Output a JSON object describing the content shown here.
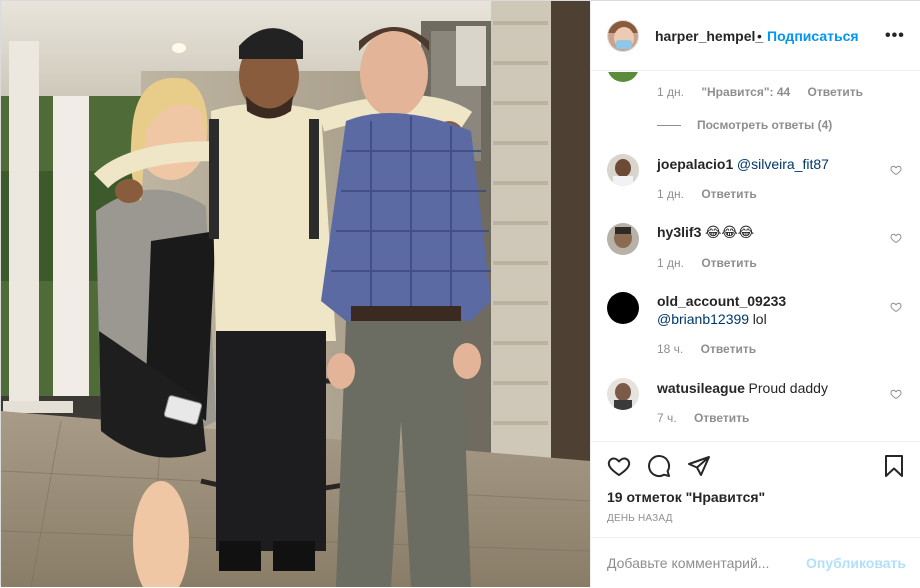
{
  "post": {
    "username": "harper_hempel_",
    "separator": "•",
    "follow_label": "Подписаться",
    "more_icon": "more-horizontal-icon"
  },
  "prev_comment": {
    "time": "1 дн.",
    "likes": "\"Нравится\": 44",
    "reply_label": "Ответить",
    "view_replies": "Посмотреть ответы (4)"
  },
  "comments": [
    {
      "username": "joepalacio1",
      "mention": "@silveira_fit87",
      "text": "",
      "time": "1 дн.",
      "reply_label": "Ответить"
    },
    {
      "username": "hy3lif3",
      "mention": "",
      "text": "😂😂😂",
      "time": "1 дн.",
      "reply_label": "Ответить"
    },
    {
      "username": "old_account_09233",
      "mention": "@brianb12399",
      "text": "lol",
      "time": "18 ч.",
      "reply_label": "Ответить"
    },
    {
      "username": "watusileague",
      "mention": "",
      "text": "Proud daddy",
      "time": "7 ч.",
      "reply_label": "Ответить"
    }
  ],
  "actions": {
    "like_icon": "heart-icon",
    "comment_icon": "comment-icon",
    "share_icon": "share-icon",
    "save_icon": "bookmark-icon"
  },
  "likes_text": "19 отметок \"Нравится\"",
  "date_text": "ДЕНЬ НАЗАД",
  "add_comment": {
    "placeholder": "Добавьте комментарий...",
    "publish_label": "Опубликовать"
  },
  "colors": {
    "link_blue": "#0095f6",
    "mention_blue": "#00376b",
    "publish_disabled": "#b2dffc",
    "meta_gray": "#8e8e8e",
    "border": "#efefef"
  }
}
